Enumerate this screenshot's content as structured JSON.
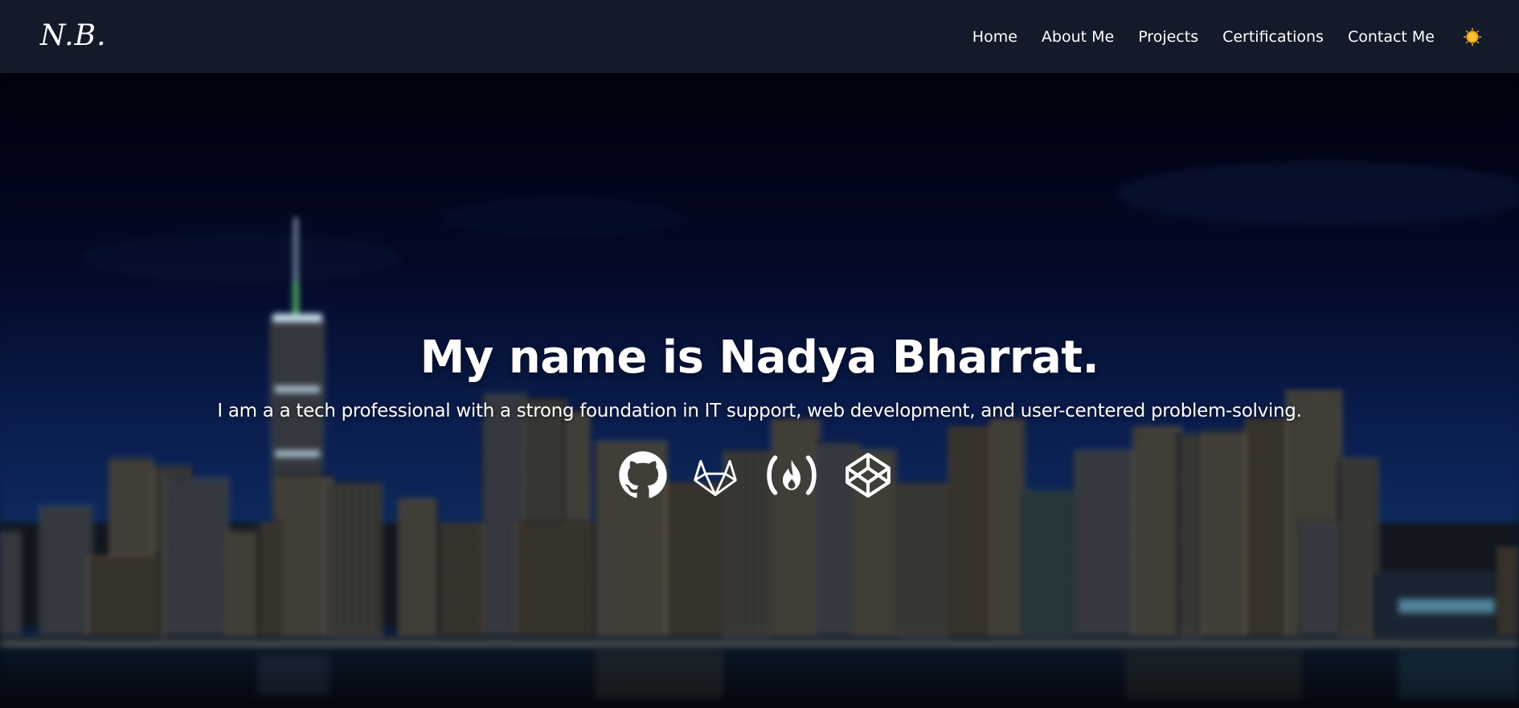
{
  "navbar": {
    "brand": "N.B.",
    "links": [
      {
        "label": "Home"
      },
      {
        "label": "About Me"
      },
      {
        "label": "Projects"
      },
      {
        "label": "Certifications"
      },
      {
        "label": "Contact Me"
      }
    ],
    "theme_toggle_icon": "sun-icon",
    "background_color": "#131a29"
  },
  "hero": {
    "title": "My name is Nadya Bharrat.",
    "subtitle": "I am a a tech professional with a strong foundation in IT support, web development, and user-centered problem-solving.",
    "background": "blurred night city skyline",
    "social_links": [
      {
        "icon": "github-icon"
      },
      {
        "icon": "gitlab-icon"
      },
      {
        "icon": "freecodecamp-icon"
      },
      {
        "icon": "codepen-icon"
      }
    ]
  }
}
